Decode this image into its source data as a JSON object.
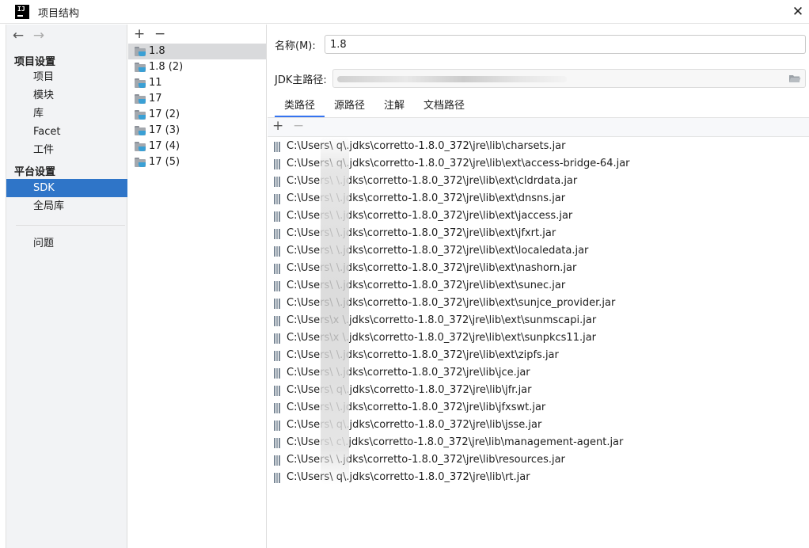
{
  "window": {
    "logo_text": "IJ",
    "title": "项目结构",
    "close_glyph": "✕"
  },
  "nav": {
    "back_glyph": "←",
    "forward_glyph": "→",
    "project_settings_header": "项目设置",
    "project_items": [
      "项目",
      "模块",
      "库",
      "Facet",
      "工件"
    ],
    "platform_settings_header": "平台设置",
    "platform_items": [
      "SDK",
      "全局库"
    ],
    "selected": "SDK",
    "problems": "问题"
  },
  "sdk_list": {
    "add_glyph": "+",
    "remove_glyph": "−",
    "items": [
      "1.8",
      "1.8 (2)",
      "11",
      "17",
      "17 (2)",
      "17 (3)",
      "17 (4)",
      "17 (5)"
    ],
    "selected_index": 0
  },
  "detail": {
    "name_label": "名称(M):",
    "name_mnemonic": "M",
    "name_value": "1.8",
    "jdk_home_label": "JDK主路径:",
    "tabs": [
      "类路径",
      "源路径",
      "注解",
      "文档路径"
    ],
    "active_tab": "类路径",
    "add_glyph": "+",
    "remove_glyph": "−",
    "classpath": [
      "C:\\Users\\  q\\.jdks\\corretto-1.8.0_372\\jre\\lib\\charsets.jar",
      "C:\\Users\\  q\\.jdks\\corretto-1.8.0_372\\jre\\lib\\ext\\access-bridge-64.jar",
      "C:\\Users\\  \\.jdks\\corretto-1.8.0_372\\jre\\lib\\ext\\cldrdata.jar",
      "C:\\Users\\  \\.jdks\\corretto-1.8.0_372\\jre\\lib\\ext\\dnsns.jar",
      "C:\\Users\\  \\.jdks\\corretto-1.8.0_372\\jre\\lib\\ext\\jaccess.jar",
      "C:\\Users\\  \\.jdks\\corretto-1.8.0_372\\jre\\lib\\ext\\jfxrt.jar",
      "C:\\Users\\  \\.jdks\\corretto-1.8.0_372\\jre\\lib\\ext\\localedata.jar",
      "C:\\Users\\  \\.jdks\\corretto-1.8.0_372\\jre\\lib\\ext\\nashorn.jar",
      "C:\\Users\\  \\.jdks\\corretto-1.8.0_372\\jre\\lib\\ext\\sunec.jar",
      "C:\\Users\\  \\.jdks\\corretto-1.8.0_372\\jre\\lib\\ext\\sunjce_provider.jar",
      "C:\\Users\\x \\.jdks\\corretto-1.8.0_372\\jre\\lib\\ext\\sunmscapi.jar",
      "C:\\Users\\x \\.jdks\\corretto-1.8.0_372\\jre\\lib\\ext\\sunpkcs11.jar",
      "C:\\Users\\  \\.jdks\\corretto-1.8.0_372\\jre\\lib\\ext\\zipfs.jar",
      "C:\\Users\\  \\.jdks\\corretto-1.8.0_372\\jre\\lib\\jce.jar",
      "C:\\Users\\  q\\.jdks\\corretto-1.8.0_372\\jre\\lib\\jfr.jar",
      "C:\\Users\\  \\.jdks\\corretto-1.8.0_372\\jre\\lib\\jfxswt.jar",
      "C:\\Users\\  q\\.jdks\\corretto-1.8.0_372\\jre\\lib\\jsse.jar",
      "C:\\Users\\  c\\.jdks\\corretto-1.8.0_372\\jre\\lib\\management-agent.jar",
      "C:\\Users\\  \\.jdks\\corretto-1.8.0_372\\jre\\lib\\resources.jar",
      "C:\\Users\\  q\\.jdks\\corretto-1.8.0_372\\jre\\lib\\rt.jar"
    ]
  },
  "colors": {
    "selection_blue": "#2f75c8",
    "tab_underline": "#3574f0",
    "panel_bg": "#f2f3f5"
  }
}
